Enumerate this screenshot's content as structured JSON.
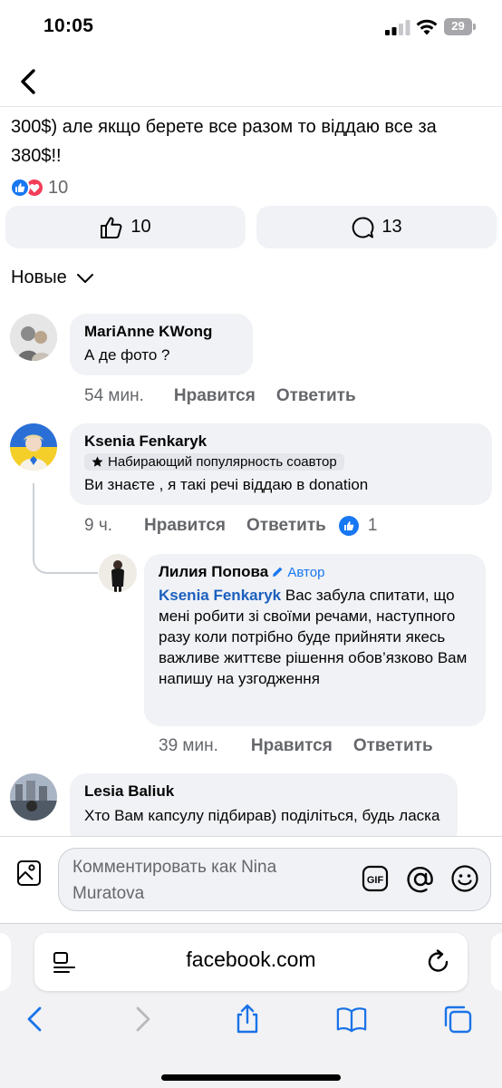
{
  "status_bar": {
    "time": "10:05",
    "battery": "29"
  },
  "post": {
    "text": "300$) але якщо берете все разом то віддаю все за 380$!!",
    "reaction_count": "10",
    "like_count": "10",
    "comment_count": "13"
  },
  "sort": {
    "label": "Новые"
  },
  "comments": [
    {
      "author": "MariAnne KWong",
      "text": "А де фото ?",
      "time": "54 мин.",
      "like_label": "Нравится",
      "reply_label": "Ответить"
    },
    {
      "author": "Ksenia Fenkaryk",
      "badge": "Набирающий популярность соавтор",
      "text": "Ви знаєте , я такі речі віддаю в donation",
      "time": "9 ч.",
      "like_label": "Нравится",
      "reply_label": "Ответить",
      "likes": "1"
    },
    {
      "author": "Лилия Попова",
      "author_tag": "Автор",
      "mention": "Ksenia Fenkaryk",
      "text": "Вас забула спитати, що мені робити зі своїми речами, наступного разу коли потрібно буде прийняти якесь важливе життєве рішення  обов’язково Вам напишу на узгодження",
      "time": "39 мин.",
      "like_label": "Нравится",
      "reply_label": "Ответить"
    },
    {
      "author": "Lesia Baliuk",
      "text": "Хто Вам капсулу підбирав) поділіться, будь ласка"
    }
  ],
  "composer": {
    "placeholder": "Комментировать как Nina Muratova"
  },
  "browser": {
    "url": "facebook.com"
  },
  "colors": {
    "accent": "#1877f2",
    "love": "#f33e58",
    "bubble": "#f0f2f5",
    "muted": "#65676b"
  }
}
